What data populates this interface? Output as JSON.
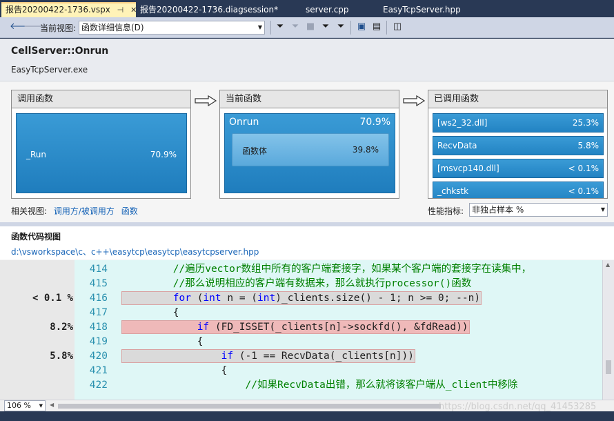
{
  "tabs": [
    {
      "label": "报告20200422-1736.vspx",
      "active": true
    },
    {
      "label": "报告20200422-1736.diagsession*",
      "active": false
    },
    {
      "label": "server.cpp",
      "active": false
    },
    {
      "label": "EasyTcpServer.hpp",
      "active": false
    }
  ],
  "toolbar": {
    "view_label": "当前视图:",
    "view_value": "函数详细信息(D)"
  },
  "header": {
    "function_name": "CellServer::Onrun",
    "module_name": "EasyTcpServer.exe"
  },
  "callers": {
    "title": "调用函数",
    "items": [
      {
        "name": "_Run",
        "value": "70.9%"
      }
    ]
  },
  "current": {
    "title": "当前函数",
    "name": "Onrun",
    "value": "70.9%",
    "body": {
      "name": "函数体",
      "value": "39.8%"
    }
  },
  "callees": {
    "title": "已调用函数",
    "items": [
      {
        "name": "[ws2_32.dll]",
        "value": "25.3%"
      },
      {
        "name": "RecvData",
        "value": "5.8%"
      },
      {
        "name": "[msvcp140.dll]",
        "value": "< 0.1%"
      },
      {
        "name": "_chkstk",
        "value": "< 0.1%"
      }
    ]
  },
  "related": {
    "label": "相关视图:",
    "links": [
      "调用方/被调用方",
      "函数"
    ]
  },
  "metric": {
    "label": "性能指标:",
    "value": "非独占样本 %"
  },
  "code_view": {
    "title": "函数代码视图",
    "path": "d:\\vsworkspace\\c、c++\\easytcp\\easytcp\\easytcpserver.hpp"
  },
  "code_lines": [
    {
      "num": "414",
      "pct": "",
      "indent": "            ",
      "parts": [
        {
          "c": "cm",
          "t": "//遍历vector数组中所有的客户端套接字，如果某个客户端的套接字在读集中，"
        }
      ]
    },
    {
      "num": "415",
      "pct": "",
      "indent": "            ",
      "parts": [
        {
          "c": "cm",
          "t": "//那么说明相应的客户端有数据来，那么就执行processor()函数"
        }
      ]
    },
    {
      "num": "416",
      "pct": "< 0.1 %",
      "indent": "            ",
      "parts": [
        {
          "c": "kw",
          "t": "for"
        },
        {
          "c": "",
          "t": " ("
        },
        {
          "c": "kw",
          "t": "int"
        },
        {
          "c": "",
          "t": " n = ("
        },
        {
          "c": "kw",
          "t": "int"
        },
        {
          "c": "",
          "t": ")_clients.size() - 1; n >= 0; --n)"
        }
      ]
    },
    {
      "num": "417",
      "pct": "",
      "indent": "            ",
      "parts": [
        {
          "c": "",
          "t": "{"
        }
      ]
    },
    {
      "num": "418",
      "pct": "8.2%",
      "indent": "                ",
      "parts": [
        {
          "c": "kw",
          "t": "if"
        },
        {
          "c": "",
          "t": " (FD_ISSET(_clients[n]->sockfd(), &fdRead))"
        }
      ]
    },
    {
      "num": "419",
      "pct": "",
      "indent": "                ",
      "parts": [
        {
          "c": "",
          "t": "{"
        }
      ]
    },
    {
      "num": "420",
      "pct": "5.8%",
      "indent": "                    ",
      "parts": [
        {
          "c": "kw",
          "t": "if"
        },
        {
          "c": "",
          "t": " (-1 == RecvData(_clients[n]))"
        }
      ]
    },
    {
      "num": "421",
      "pct": "",
      "indent": "                    ",
      "parts": [
        {
          "c": "",
          "t": "{"
        }
      ]
    },
    {
      "num": "422",
      "pct": "",
      "indent": "                        ",
      "parts": [
        {
          "c": "cm",
          "t": "//如果RecvData出错，那么就将该客户端从_client中移除"
        }
      ]
    }
  ],
  "zoom": "106 %",
  "watermark": "https://blog.csdn.net/qq_41453285",
  "colors": {
    "accent_blue": "#2283c3",
    "tab_active": "#fff3b8",
    "code_bg": "#dff7f6",
    "hot_line": "#efb9b9"
  }
}
